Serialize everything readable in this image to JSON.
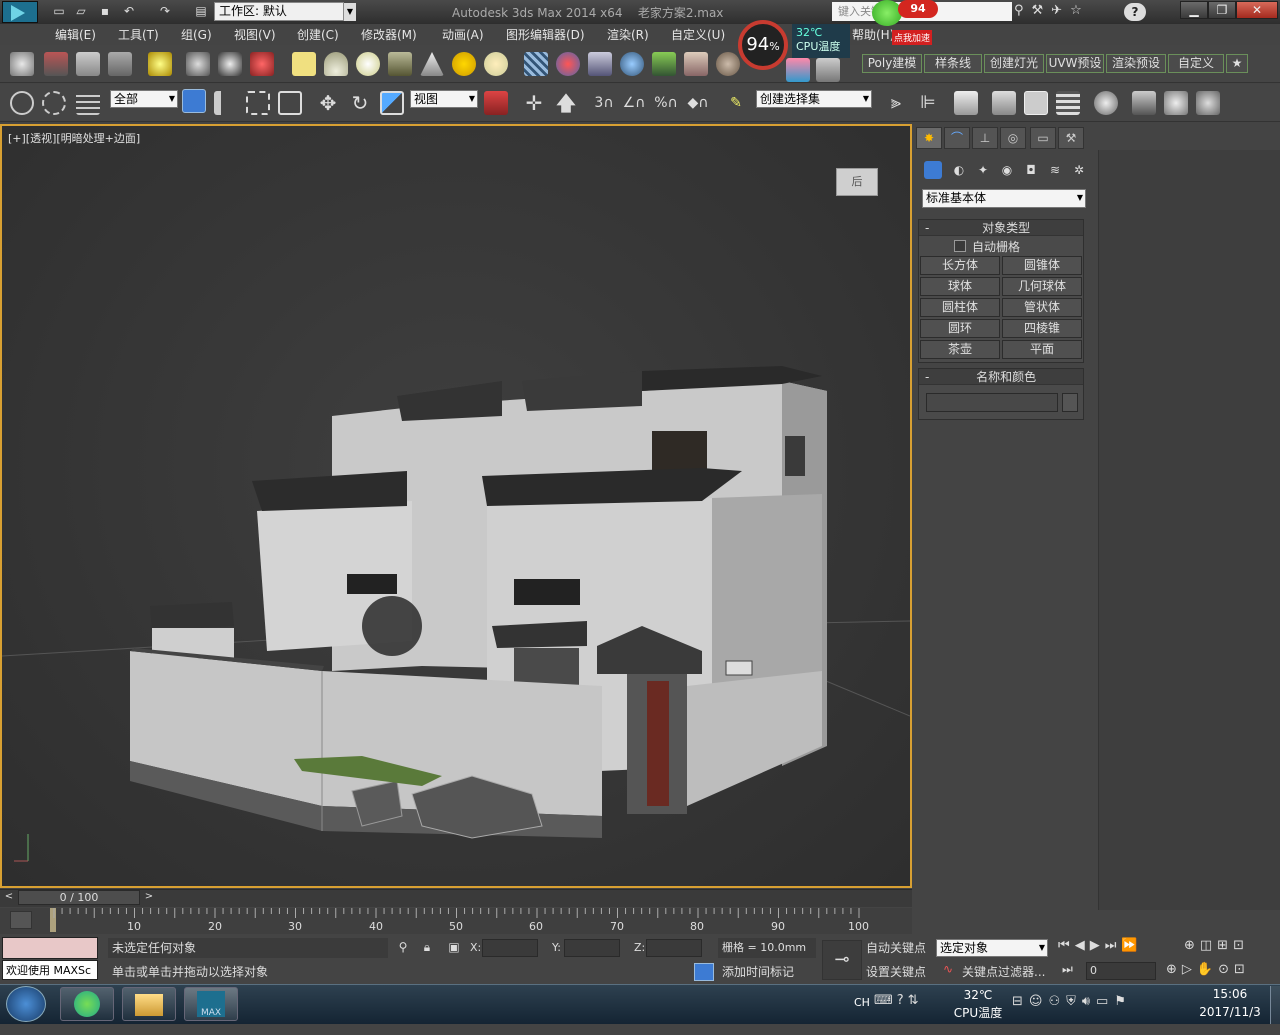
{
  "app": {
    "title": "Autodesk 3ds Max  2014 x64",
    "filename": "老家方案2.max",
    "workspace": "工作区: 默认",
    "search_placeholder": "键入关键字或短语"
  },
  "menubar": {
    "items": [
      "编辑(E)",
      "工具(T)",
      "组(G)",
      "视图(V)",
      "创建(C)",
      "修改器(M)",
      "动画(A)",
      "图形编辑器(D)",
      "渲染(R)",
      "自定义(U)",
      "帮助(H)"
    ]
  },
  "cpu_widget": {
    "percent": "94",
    "percent_unit": "%",
    "temp": "32℃",
    "temp_label": "CPU温度",
    "badge": "94",
    "accelerate": "点我加速"
  },
  "ribbon_tabs": [
    "Poly建模",
    "样条线",
    "创建灯光",
    "UVW预设",
    "渲染预设",
    "自定义",
    "★"
  ],
  "toolbar2": {
    "selection_filter": "全部",
    "ref_coord": "视图",
    "named_selection": "创建选择集"
  },
  "viewport": {
    "label": "[+][透视][明暗处理+边面]",
    "viewcube_label": "后"
  },
  "command_panel": {
    "category": "标准基本体",
    "object_type_title": "对象类型",
    "autogrid_label": "自动栅格",
    "objects": [
      "长方体",
      "圆锥体",
      "球体",
      "几何球体",
      "圆柱体",
      "管状体",
      "圆环",
      "四棱锥",
      "茶壶",
      "平面"
    ],
    "name_color_title": "名称和颜色",
    "name_value": ""
  },
  "timeline": {
    "frame_display": "0 / 100",
    "ticks": [
      "10",
      "20",
      "30",
      "40",
      "50",
      "60",
      "70",
      "80",
      "90",
      "100"
    ]
  },
  "status": {
    "welcome": "欢迎使用 MAXSc",
    "selection_status": "未选定任何对象",
    "prompt": "单击或单击并拖动以选择对象",
    "x_label": "X:",
    "y_label": "Y:",
    "z_label": "Z:",
    "x_value": "",
    "y_value": "",
    "z_value": "",
    "grid": "栅格 = 10.0mm",
    "add_time_tag": "添加时间标记",
    "auto_key": "自动关键点",
    "set_key": "设置关键点",
    "key_mode": "选定对象",
    "key_filters": "关键点过滤器...",
    "frame": "0"
  },
  "taskbar": {
    "lang": "CH",
    "cpu_temp": "32℃",
    "cpu_temp_label": "CPU温度",
    "time": "15:06",
    "date": "2017/11/3",
    "max_app_label": "MAX"
  },
  "colors": {
    "accent_border": "#d8a032",
    "ribbon_green": "#6a8f5a",
    "cpu_red": "#c83b30"
  }
}
